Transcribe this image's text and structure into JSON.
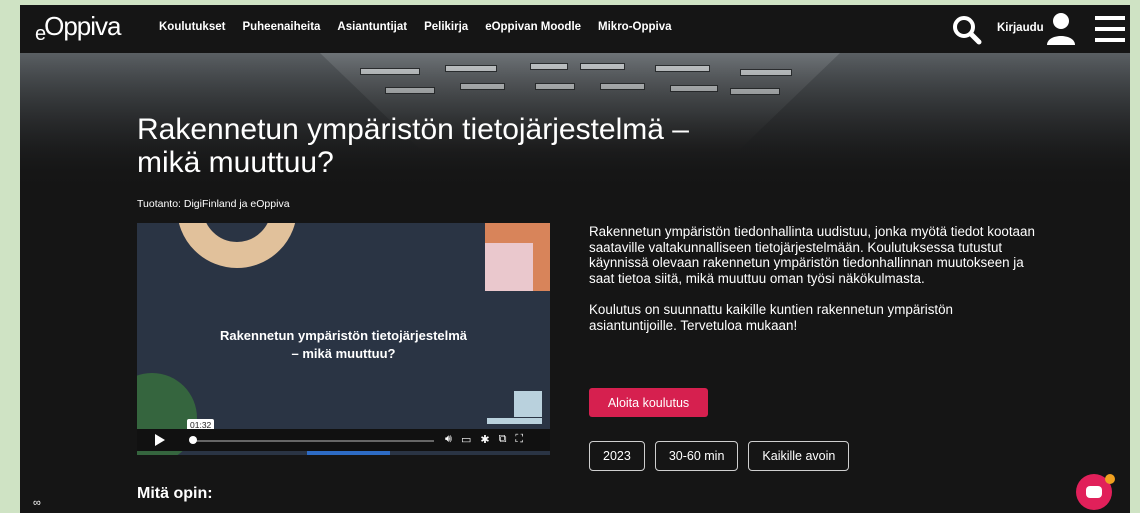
{
  "nav": {
    "logo_e": "e",
    "logo_text": "Oppiva",
    "links": [
      "Koulutukset",
      "Puheenaiheita",
      "Asiantuntijat",
      "Pelikirja",
      "eOppivan Moodle",
      "Mikro-Oppiva"
    ],
    "login": "Kirjaudu",
    "icons": [
      "search-icon",
      "user-icon",
      "hamburger-menu-icon"
    ]
  },
  "course": {
    "title": "Rakennetun ympäristön tietojärjestelmä – mikä muuttuu?",
    "producer": "Tuotanto: DigiFinland ja eOppiva",
    "description_1": "Rakennetun ympäristön tiedonhallinta uudistuu, jonka myötä tiedot kootaan saataville valtakunnalliseen tietojärjestelmään. Koulutuksessa tutustut käynnissä olevaan rakennetun ympäristön tiedonhallinnan muutokseen ja saat tietoa siitä, mikä muuttuu oman työsi näkökulmasta.",
    "description_2": "Koulutus on suunnattu kaikille kuntien rakennetun ympäristön asiantuntijoille. Tervetuloa mukaan!",
    "start_button": "Aloita koulutus",
    "tags": [
      "2023",
      "30-60 min",
      "Kaikille avoin"
    ],
    "section_heading": "Mitä opin:"
  },
  "video": {
    "title_line1": "Rakennetun ympäristön tietojärjestelmä",
    "title_line2": "– mikä muuttuu?",
    "time": "01:32",
    "colors": {
      "ring": "#e1c19b",
      "orange": "#d8845a",
      "pink": "#eac8cd",
      "green": "#35653e",
      "blue": "#b9d1dd",
      "background": "#2a3444"
    }
  },
  "colors": {
    "accent": "#d6204f",
    "background": "#151515",
    "page_bg": "#cfe3c4"
  }
}
